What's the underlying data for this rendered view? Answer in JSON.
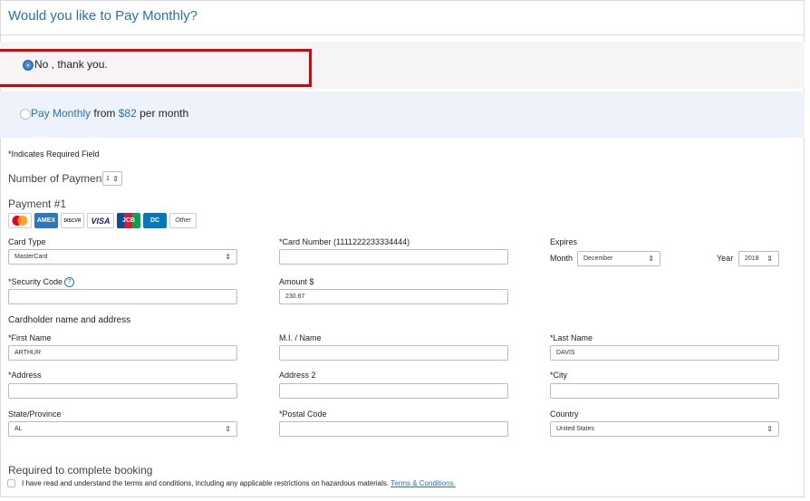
{
  "title": "Would you like to Pay Monthly?",
  "options": {
    "no_label": "No , thank you.",
    "monthly_label": "Pay Monthly",
    "monthly_from": "from",
    "monthly_amount": "$82",
    "monthly_per": "per month"
  },
  "required_note": "*Indicates Required Field",
  "number_of_payments": {
    "label": "Number of Payments",
    "value": "1"
  },
  "payment_heading": "Payment #1",
  "card_logos": [
    "Mastercard",
    "AMEX",
    "Discover",
    "VISA",
    "JCB",
    "Diners Club",
    "Other"
  ],
  "form": {
    "card_type": {
      "label": "Card Type",
      "value": "MasterCard"
    },
    "card_number": {
      "label": "*Card Number (1111222233334444)",
      "value": ""
    },
    "expires": {
      "label": "Expires",
      "month_label": "Month",
      "month_value": "December",
      "year_label": "Year",
      "year_value": "2018"
    },
    "security_code": {
      "label": "*Security Code",
      "value": ""
    },
    "amount": {
      "label": "Amount $",
      "value": "230.67"
    },
    "cardholder_heading": "Cardholder name and address",
    "first_name": {
      "label": "*First Name",
      "value": "ARTHUR"
    },
    "mi_name": {
      "label": "M.I. / Name",
      "value": ""
    },
    "last_name": {
      "label": "*Last Name",
      "value": "DAVIS"
    },
    "address": {
      "label": "*Address",
      "value": ""
    },
    "address2": {
      "label": "Address 2",
      "value": ""
    },
    "city": {
      "label": "*City",
      "value": ""
    },
    "state": {
      "label": "State/Province",
      "value": "AL"
    },
    "postal_code": {
      "label": "*Postal Code",
      "value": ""
    },
    "country": {
      "label": "Country",
      "value": "United States"
    }
  },
  "booking": {
    "heading": "Required to complete booking",
    "terms_text": "I have read and understand the terms and conditions, including any applicable restrictions on hazardous materials.",
    "terms_link": "Terms & Conditions."
  },
  "colors": {
    "link": "#2a6fb8",
    "highlight": "#e00000"
  }
}
